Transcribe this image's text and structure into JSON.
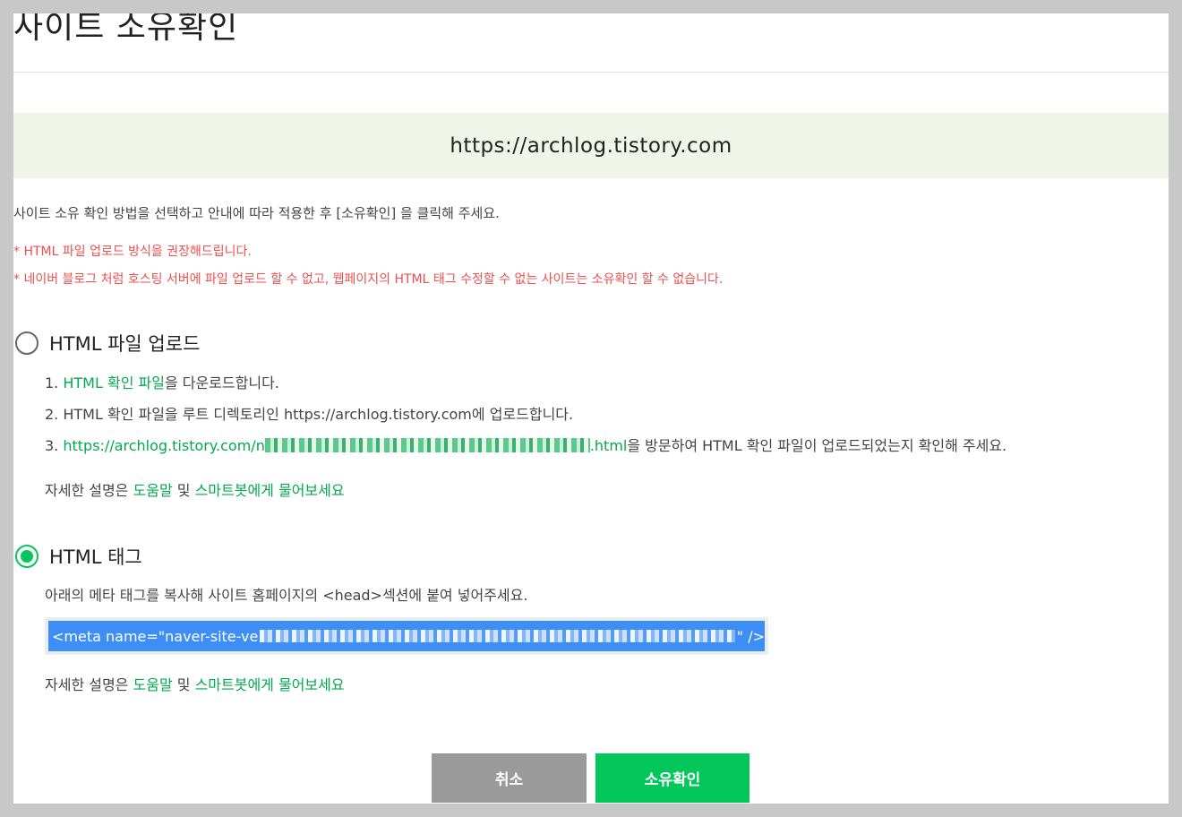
{
  "header": {
    "title": "사이트 소유확인"
  },
  "site": {
    "url": "https://archlog.tistory.com"
  },
  "instructions": {
    "main": "사이트 소유 확인 방법을 선택하고 안내에 따라 적용한 후 [소유확인] 을 클릭해 주세요.",
    "warning1": "* HTML 파일 업로드 방식을 권장해드립니다.",
    "warning2": "* 네이버 블로그 처럼 호스팅 서버에 파일 업로드 할 수 없고, 웹페이지의 HTML 태그 수정할 수 없는 사이트는 소유확인 할 수 없습니다."
  },
  "options": {
    "file_upload": {
      "label": "HTML 파일 업로드",
      "selected": false,
      "step1_prefix": "1. ",
      "step1_link": "HTML 확인 파일",
      "step1_suffix": "을 다운로드합니다.",
      "step2": "2. HTML 확인 파일을 루트 디렉토리인 https://archlog.tistory.com에 업로드합니다.",
      "step3_prefix": "3. ",
      "step3_link_start": "https://archlog.tistory.com/n",
      "step3_link_end": ".html",
      "step3_suffix": "을 방문하여 HTML 확인 파일이 업로드되었는지 확인해 주세요.",
      "help_prefix": "자세한 설명은 ",
      "help_link1": "도움말",
      "help_mid": " 및 ",
      "help_link2": "스마트봇에게 물어보세요"
    },
    "html_tag": {
      "label": "HTML 태그",
      "selected": true,
      "desc": "아래의 메타 태그를 복사해 사이트 홈페이지의 <head>섹션에 붙여 넣어주세요.",
      "meta_start": "<meta name=\"naver-site-ve",
      "meta_end": "\" />",
      "help_prefix": "자세한 설명은 ",
      "help_link1": "도움말",
      "help_mid": " 및 ",
      "help_link2": "스마트봇에게 물어보세요"
    }
  },
  "buttons": {
    "cancel": "취소",
    "confirm": "소유확인"
  },
  "colors": {
    "accent": "#03c75a",
    "link": "#03a94e",
    "warning": "#f04f4f",
    "banner_bg": "#eff5e9",
    "cancel_bg": "#9a9a9a",
    "selection": "#3d8ef5"
  }
}
